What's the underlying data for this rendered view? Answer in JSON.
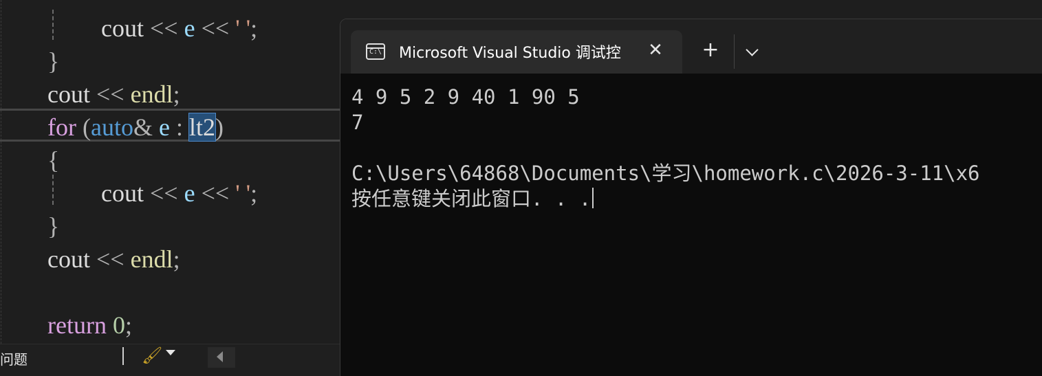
{
  "editor": {
    "lines": [
      {
        "indent": "    ",
        "tokens": [
          [
            "fn",
            "cout"
          ],
          [
            "op",
            " << "
          ],
          [
            "var",
            "e"
          ],
          [
            "op",
            " << "
          ],
          [
            "str",
            "' '"
          ],
          [
            "op",
            ";"
          ]
        ]
      },
      {
        "indent": "",
        "tokens": [
          [
            "op",
            "}"
          ]
        ]
      },
      {
        "indent": "",
        "tokens": [
          [
            "fn",
            "cout"
          ],
          [
            "op",
            " << "
          ],
          [
            "endl",
            "endl"
          ],
          [
            "op",
            ";"
          ]
        ]
      },
      {
        "indent": "",
        "tokens": [
          [
            "kw",
            "for"
          ],
          [
            "op",
            " ("
          ],
          [
            "kw2",
            "auto"
          ],
          [
            "op",
            "& "
          ],
          [
            "var",
            "e"
          ],
          [
            "op",
            " : "
          ],
          [
            "hl",
            "lt2"
          ],
          [
            "op",
            ")"
          ]
        ]
      },
      {
        "indent": "",
        "tokens": [
          [
            "op",
            "{"
          ]
        ]
      },
      {
        "indent": "    ",
        "tokens": [
          [
            "fn",
            "cout"
          ],
          [
            "op",
            " << "
          ],
          [
            "var",
            "e"
          ],
          [
            "op",
            " << "
          ],
          [
            "str",
            "' '"
          ],
          [
            "op",
            ";"
          ]
        ]
      },
      {
        "indent": "",
        "tokens": [
          [
            "op",
            "}"
          ]
        ]
      },
      {
        "indent": "",
        "tokens": [
          [
            "fn",
            "cout"
          ],
          [
            "op",
            " << "
          ],
          [
            "endl",
            "endl"
          ],
          [
            "op",
            ";"
          ]
        ]
      },
      {
        "indent": "",
        "tokens": []
      },
      {
        "indent": "",
        "tokens": [
          [
            "kw",
            "return"
          ],
          [
            "op",
            " "
          ],
          [
            "num",
            "0"
          ],
          [
            "op",
            ";"
          ]
        ]
      }
    ]
  },
  "statusbar": {
    "panel_label": "问题",
    "brush_icon": "brush-icon"
  },
  "terminal": {
    "tab_title": "Microsoft Visual Studio 调试控",
    "close_glyph": "✕",
    "new_tab_glyph": "+",
    "output": [
      "4 9 5 2 9 40 1 90 5",
      "7",
      "",
      "C:\\Users\\64868\\Documents\\学习\\homework.c\\2026-3-11\\x6",
      "按任意键关闭此窗口. . ."
    ]
  }
}
